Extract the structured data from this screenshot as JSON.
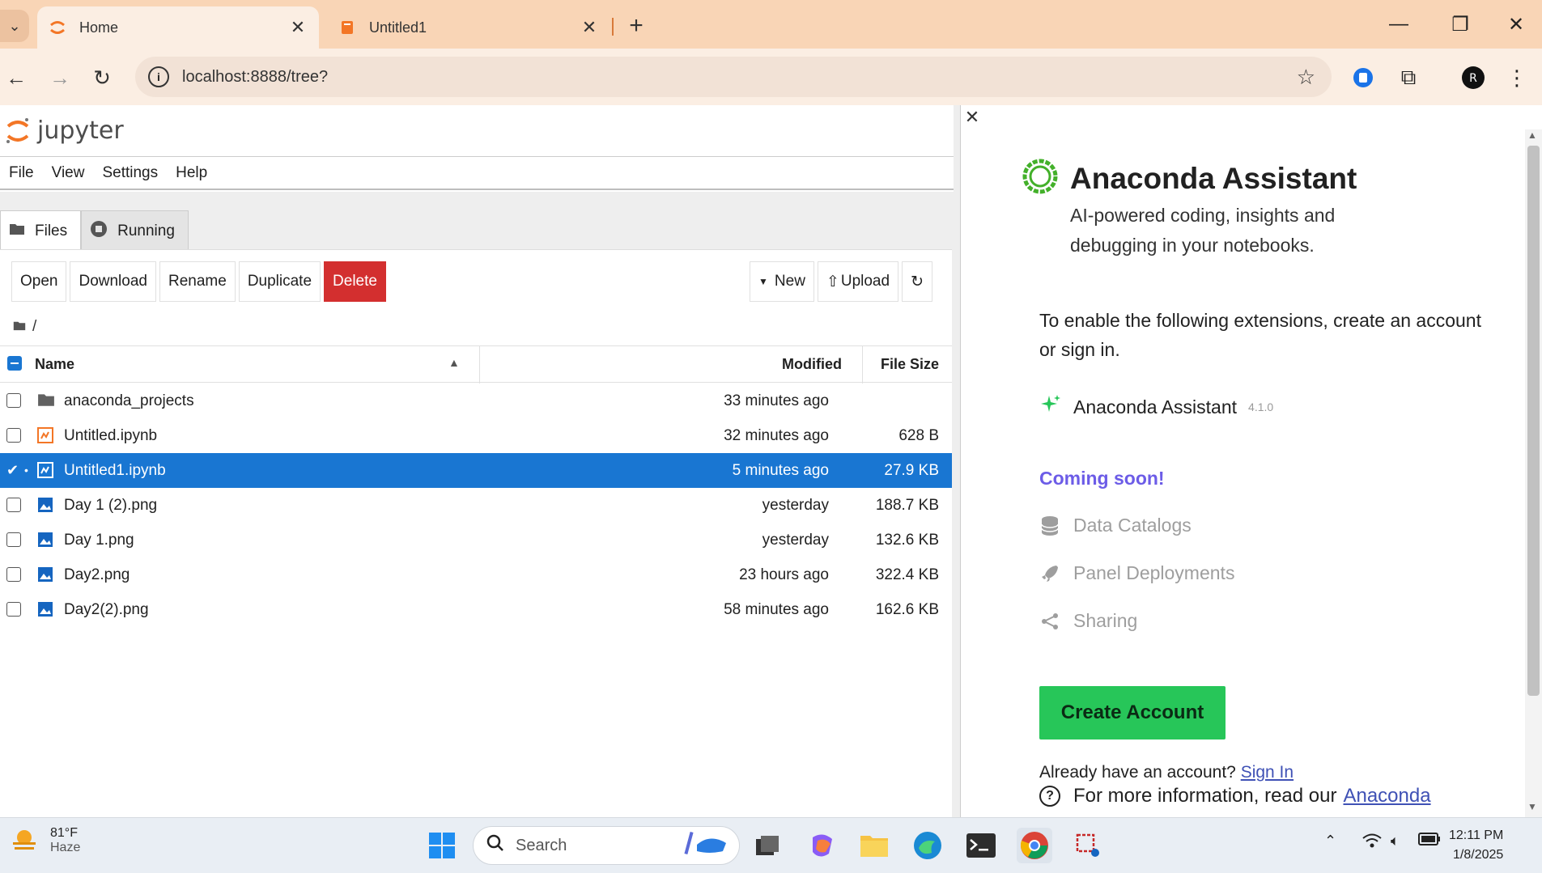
{
  "browser": {
    "tabs": [
      {
        "title": "Home",
        "active": true
      },
      {
        "title": "Untitled1",
        "active": false
      }
    ],
    "url": "localhost:8888/tree?"
  },
  "jupyter": {
    "logo_text": "jupyter",
    "menu": [
      "File",
      "View",
      "Settings",
      "Help"
    ],
    "side_tabs": [
      "Files",
      "Running"
    ],
    "toolbar_left": [
      "Open",
      "Download",
      "Rename",
      "Duplicate",
      "Delete"
    ],
    "toolbar_right": {
      "new": "New",
      "upload": "Upload"
    },
    "breadcrumb": "/",
    "columns": {
      "name": "Name",
      "modified": "Modified",
      "size": "File Size"
    },
    "files": [
      {
        "name": "anaconda_projects",
        "type": "folder",
        "modified": "33 minutes ago",
        "size": "",
        "selected": false
      },
      {
        "name": "Untitled.ipynb",
        "type": "notebook",
        "modified": "32 minutes ago",
        "size": "628 B",
        "selected": false
      },
      {
        "name": "Untitled1.ipynb",
        "type": "notebook",
        "modified": "5 minutes ago",
        "size": "27.9 KB",
        "selected": true
      },
      {
        "name": "Day 1 (2).png",
        "type": "image",
        "modified": "yesterday",
        "size": "188.7 KB",
        "selected": false
      },
      {
        "name": "Day 1.png",
        "type": "image",
        "modified": "yesterday",
        "size": "132.6 KB",
        "selected": false
      },
      {
        "name": "Day2.png",
        "type": "image",
        "modified": "23 hours ago",
        "size": "322.4 KB",
        "selected": false
      },
      {
        "name": "Day2(2).png",
        "type": "image",
        "modified": "58 minutes ago",
        "size": "162.6 KB",
        "selected": false
      }
    ]
  },
  "assistant": {
    "title": "Anaconda Assistant",
    "subtitle": "AI-powered coding, insights and debugging in your notebooks.",
    "enable_text": "To enable the following extensions, create an account or sign in.",
    "extension": {
      "name": "Anaconda Assistant",
      "version": "4.1.0"
    },
    "coming_soon": "Coming soon!",
    "upcoming": [
      "Data Catalogs",
      "Panel Deployments",
      "Sharing"
    ],
    "create_account": "Create Account",
    "already_text": "Already have an account?",
    "sign_in": "Sign In",
    "more_text": "For more information, read our",
    "more_link": "Anaconda"
  },
  "taskbar": {
    "weather_temp": "81°F",
    "weather_desc": "Haze",
    "search_placeholder": "Search",
    "time": "12:11 PM",
    "date": "1/8/2025"
  },
  "colors": {
    "tabbar": "#f9d5b6",
    "selected_row": "#1976d2",
    "delete_button": "#d32f2f",
    "create_account": "#27c659",
    "coming_soon": "#6c5ce7"
  }
}
